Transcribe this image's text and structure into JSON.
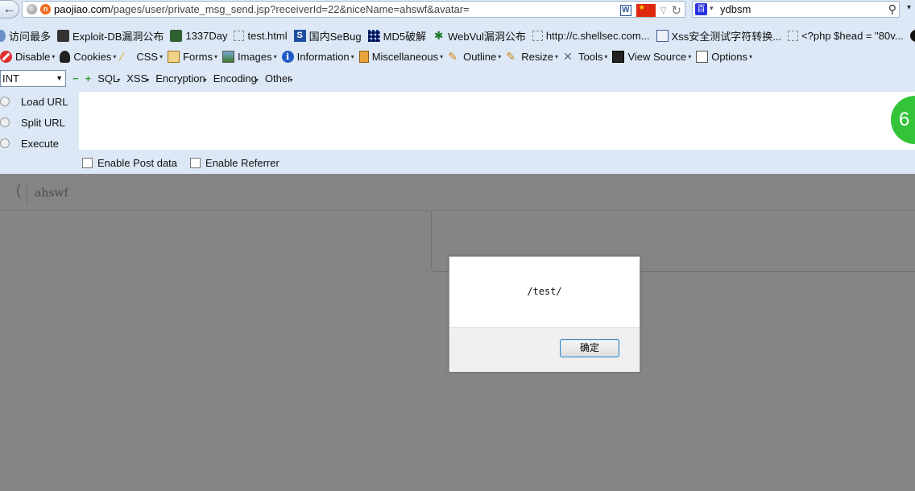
{
  "browser": {
    "url_host": "paojiao.com",
    "url_path": "/pages/user/private_msg_send.jsp?receiverId=22&niceName=ahswf&avatar=",
    "search_text": "ydbsm"
  },
  "bookmarks": [
    {
      "label": "访问最多"
    },
    {
      "label": "Exploit-DB漏洞公布"
    },
    {
      "label": "1337Day"
    },
    {
      "label": "test.html"
    },
    {
      "label": "国内SeBug"
    },
    {
      "label": "MD5破解"
    },
    {
      "label": "WebVul漏洞公布"
    },
    {
      "label": "http://c.shellsec.com..."
    },
    {
      "label": "Xss安全测试字符转换..."
    },
    {
      "label": "<?php $head = \"80v..."
    }
  ],
  "webdev": [
    {
      "label": "Disable"
    },
    {
      "label": "Cookies"
    },
    {
      "label": "CSS"
    },
    {
      "label": "Forms"
    },
    {
      "label": "Images"
    },
    {
      "label": "Information"
    },
    {
      "label": "Miscellaneous"
    },
    {
      "label": "Outline"
    },
    {
      "label": "Resize"
    },
    {
      "label": "Tools"
    },
    {
      "label": "View Source"
    },
    {
      "label": "Options"
    }
  ],
  "hackbar": {
    "select_value": "INT",
    "menus": [
      "SQL",
      "XSS",
      "Encryption",
      "Encoding",
      "Other"
    ],
    "load_url": "Load URL",
    "split_url": "Split URL",
    "execute": "Execute",
    "enable_post": "Enable Post data",
    "enable_referrer": "Enable Referrer",
    "badge": "6"
  },
  "page": {
    "receiver_name": "ahswf"
  },
  "dialog": {
    "message": "/test/",
    "ok_label": "确定"
  }
}
